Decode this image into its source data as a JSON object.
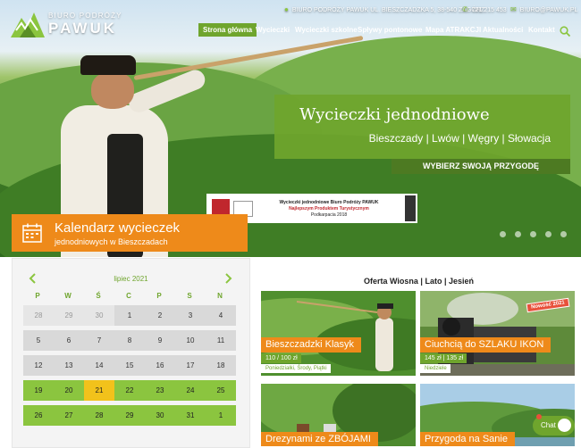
{
  "brand": {
    "small": "BIURO PODRÓŻY",
    "big": "PAWUK",
    "accent": "#6fa52d",
    "orange": "#ee8a1a"
  },
  "topbar": {
    "address": "BIURO PODRÓŻY PAWUK UL. BIESZCZADZKA 5, 38-540 ZAGÓRZ",
    "phone": "721 215 453",
    "email": "BIURO@PAWUK.PL"
  },
  "nav": {
    "items": [
      "Strona główna",
      "Wycieczki",
      "Wycieczki szkolne",
      "Spływy pontonowe",
      "Mapa ATRAKCJI",
      "Aktualności",
      "Kontakt"
    ],
    "active": "Strona główna"
  },
  "slide": {
    "title": "Wycieczki jednodniowe",
    "subtitle": "Bieszczady | Lwów | Węgry | Słowacja",
    "cta": "WYBIERZ SWOJĄ PRZYGODĘ"
  },
  "award": {
    "line1": "Wycieczki jednodniowe Biuro Podróży PAWUK",
    "line2": "Najlepszym Produktem Turystycznym",
    "line3": "Podkarpacia 2018"
  },
  "calendar": {
    "title": "Kalendarz wycieczek",
    "subtitle": "jednodniowych w Bieszczadach",
    "month": "lipiec 2021",
    "dows": [
      "P",
      "W",
      "Ś",
      "C",
      "P",
      "S",
      "N"
    ],
    "rows": [
      [
        "28",
        "29",
        "30",
        "1",
        "2",
        "3",
        "4"
      ],
      [
        "5",
        "6",
        "7",
        "8",
        "9",
        "10",
        "11"
      ],
      [
        "12",
        "13",
        "14",
        "15",
        "16",
        "17",
        "18"
      ],
      [
        "19",
        "20",
        "21",
        "22",
        "23",
        "24",
        "25"
      ],
      [
        "26",
        "27",
        "28",
        "29",
        "30",
        "31",
        "1"
      ]
    ]
  },
  "offer": {
    "title": "Oferta Wiosna | Lato | Jesień",
    "cards": [
      {
        "label": "Bieszczadzki Klasyk",
        "price": "110 / 100 zł",
        "days": "Poniedziałki, Środy, Piątki"
      },
      {
        "label": "Ciuchcią do SZLAKU IKON",
        "price": "145 zł | 135 zł",
        "days": "Niedziele",
        "badge": "Nowość 2021"
      },
      {
        "label": "Drezynami ze ZBÓJAMI"
      },
      {
        "label": "Przygoda na Sanie"
      }
    ]
  },
  "chat": {
    "label": "Chat"
  }
}
